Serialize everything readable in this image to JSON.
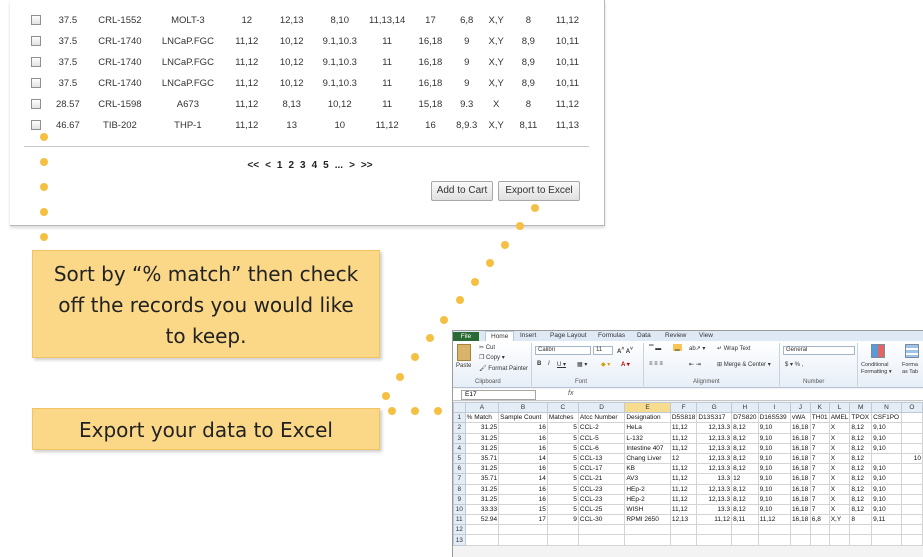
{
  "results": {
    "rows": [
      [
        "37.5",
        "CRL-1552",
        "MOLT-3",
        "12",
        "12,13",
        "8,10",
        "11,13,14",
        "17",
        "6,8",
        "X,Y",
        "8",
        "11,12"
      ],
      [
        "37.5",
        "CRL-1740",
        "LNCaP.FGC",
        "11,12",
        "10,12",
        "9.1,10.3",
        "11",
        "16,18",
        "9",
        "X,Y",
        "8,9",
        "10,11"
      ],
      [
        "37.5",
        "CRL-1740",
        "LNCaP.FGC",
        "11,12",
        "10,12",
        "9.1,10.3",
        "11",
        "16,18",
        "9",
        "X,Y",
        "8,9",
        "10,11"
      ],
      [
        "37.5",
        "CRL-1740",
        "LNCaP.FGC",
        "11,12",
        "10,12",
        "9.1,10.3",
        "11",
        "16,18",
        "9",
        "X,Y",
        "8,9",
        "10,11"
      ],
      [
        "28.57",
        "CRL-1598",
        "A673",
        "11,12",
        "8,13",
        "10,12",
        "11",
        "15,18",
        "9.3",
        "X",
        "8",
        "11,12"
      ],
      [
        "46.67",
        "TIB-202",
        "THP-1",
        "11,12",
        "13",
        "10",
        "11,12",
        "16",
        "8,9.3",
        "X,Y",
        "8,11",
        "11,13"
      ]
    ],
    "pagination": [
      "<<",
      "<",
      "1",
      "2",
      "3",
      "4",
      "5",
      "...",
      ">",
      ">>"
    ],
    "add_to_cart": "Add to Cart",
    "export_to_excel": "Export to Excel"
  },
  "callouts": {
    "sort_line1": "Sort by “% match” then check",
    "sort_line2": "off the records you would like",
    "sort_line3": "to keep.",
    "export": "Export your data to Excel"
  },
  "excel": {
    "tabs": [
      "File",
      "Home",
      "Insert",
      "Page Layout",
      "Formulas",
      "Data",
      "Review",
      "View"
    ],
    "clipboard": {
      "paste": "Paste",
      "cut": "Cut",
      "copy": "Copy ▾",
      "format_painter": "Format Painter",
      "label": "Clipboard"
    },
    "font": {
      "name": "Calibri",
      "size": "11",
      "label": "Font"
    },
    "alignment": {
      "wrap": "Wrap Text",
      "merge": "Merge & Center ▾",
      "label": "Alignment"
    },
    "number": {
      "format": "General",
      "symbols": "$ ▾  %  ,",
      "label": "Number"
    },
    "styles": {
      "conditional_1": "Conditional",
      "conditional_2": "Formatting ▾",
      "table_1": "Forma",
      "table_2": "as Tab"
    },
    "name_box": "E17",
    "fx": "fx",
    "columns": [
      "",
      "A",
      "B",
      "C",
      "D",
      "E",
      "F",
      "G",
      "H",
      "I",
      "J",
      "K",
      "L",
      "M",
      "N",
      "O"
    ],
    "rows": [
      [
        "1",
        "% Match",
        "Sample Count",
        "Matches",
        "Atcc Number",
        "Designation",
        "D5S818",
        "D13S317",
        "D7S820",
        "D16S539",
        "vWA",
        "TH01",
        "AMEL",
        "TPOX",
        "CSF1PO",
        ""
      ],
      [
        "2",
        "31.25",
        "16",
        "5",
        "CCL-2",
        "HeLa",
        "11,12",
        "12,13.3",
        "8,12",
        "9,10",
        "16,18",
        "7",
        "X",
        "8,12",
        "9,10",
        ""
      ],
      [
        "3",
        "31.25",
        "16",
        "5",
        "CCL-5",
        "L-132",
        "11,12",
        "12,13.3",
        "8,12",
        "9,10",
        "16,18",
        "7",
        "X",
        "8,12",
        "9,10",
        ""
      ],
      [
        "4",
        "31.25",
        "16",
        "5",
        "CCL-6",
        "Intestine 407",
        "11,12",
        "12,13.3",
        "8,12",
        "9,10",
        "16,18",
        "7",
        "X",
        "8,12",
        "9,10",
        ""
      ],
      [
        "5",
        "35.71",
        "14",
        "5",
        "CCL-13",
        "Chang Liver",
        "12",
        "12,13.3",
        "8,12",
        "9,10",
        "16,18",
        "7",
        "X",
        "8,12",
        "",
        "10"
      ],
      [
        "6",
        "31.25",
        "16",
        "5",
        "CCL-17",
        "KB",
        "11,12",
        "12,13.3",
        "8,12",
        "9,10",
        "16,18",
        "7",
        "X",
        "8,12",
        "9,10",
        ""
      ],
      [
        "7",
        "35.71",
        "14",
        "5",
        "CCL-21",
        "AV3",
        "11,12",
        "13.3",
        "12",
        "9,10",
        "16,18",
        "7",
        "X",
        "8,12",
        "9,10",
        ""
      ],
      [
        "8",
        "31.25",
        "16",
        "5",
        "CCL-23",
        "HEp-2",
        "11,12",
        "12,13.3",
        "8,12",
        "9,10",
        "16,18",
        "7",
        "X",
        "8,12",
        "9,10",
        ""
      ],
      [
        "9",
        "31.25",
        "16",
        "5",
        "CCL-23",
        "HEp-2",
        "11,12",
        "12,13.3",
        "8,12",
        "9,10",
        "16,18",
        "7",
        "X",
        "8,12",
        "9,10",
        ""
      ],
      [
        "10",
        "33.33",
        "15",
        "5",
        "CCL-25",
        "WISH",
        "11,12",
        "13.3",
        "8,12",
        "9,10",
        "16,18",
        "7",
        "X",
        "8,12",
        "9,10",
        ""
      ],
      [
        "11",
        "52.94",
        "17",
        "9",
        "CCL-30",
        "RPMI 2650",
        "12,13",
        "11,12",
        "8,11",
        "11,12",
        "16,18",
        "6,8",
        "X,Y",
        "8",
        "9,11",
        ""
      ],
      [
        "12",
        "",
        "",
        "",
        "",
        "",
        "",
        "",
        "",
        "",
        "",
        "",
        "",
        "",
        "",
        ""
      ],
      [
        "13",
        "",
        "",
        "",
        "",
        "",
        "",
        "",
        "",
        "",
        "",
        "",
        "",
        "",
        "",
        ""
      ]
    ]
  },
  "colors": {
    "callout_fill": "#fbd887",
    "dot": "#f5c042",
    "excel_file_tab": "#2a6b35",
    "selected_column": "#f7dc90"
  }
}
